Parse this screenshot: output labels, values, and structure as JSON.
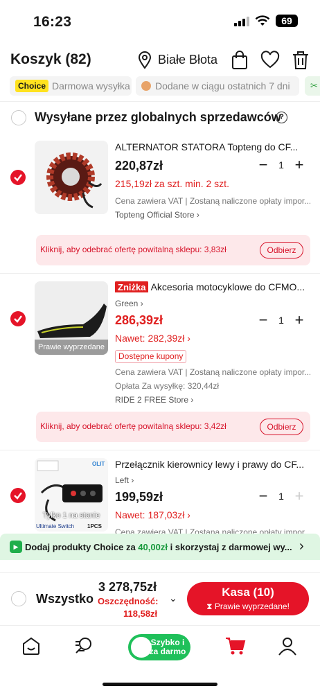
{
  "status": {
    "time": "16:23",
    "battery": "69"
  },
  "header": {
    "title": "Koszyk (82)",
    "location": "Białe Błota"
  },
  "chips": [
    {
      "badge": "Choice",
      "label": "Darmowa wysyłka"
    },
    {
      "label": "Dodane w ciągu ostatnich 7 dni"
    }
  ],
  "section": {
    "title": "Wysyłane przez globalnych sprzedawców",
    "help": "?"
  },
  "items": [
    {
      "title": "ALTERNATOR STATORA Topteng do CF...",
      "price": "220,87zł",
      "sub_price": "215,19zł za szt. min. 2 szt.",
      "vat": "Cena zawiera VAT | Zostaną naliczone opłaty impor...",
      "store": "Topteng Official Store",
      "qty": "1",
      "promo": "Kliknij, aby odebrać ofertę powitalną sklepu: 3,83zł",
      "promo_btn": "Odbierz"
    },
    {
      "tag": "Zniżka",
      "title": "Akcesoria motocyklowe do CFMO...",
      "variant": "Green",
      "price": "286,39zł",
      "sub_price": "Nawet: 282,39zł",
      "coupon": "Dostępne kupony",
      "vat": "Cena zawiera VAT | Zostaną naliczone opłaty impor...",
      "shipping": "Opłata Za wysyłkę: 320,44zł",
      "store": "RIDE 2 FREE Store",
      "qty": "1",
      "stock": "Prawie wyprzedane",
      "promo": "Kliknij, aby odebrać ofertę powitalną sklepu: 3,42zł",
      "promo_btn": "Odbierz"
    },
    {
      "title": "Przełącznik kierownicy lewy i prawy do CF...",
      "variant": "Left",
      "price": "199,59zł",
      "sub_price": "Nawet: 187,03zł",
      "vat": "Cena zawiera VAT | Zostaną naliczone opłaty impor...",
      "qty": "1",
      "stock": "Tylko 1 na stanie",
      "img_brand": "OLIT",
      "img_caption": "Ultimate Switch",
      "img_count": "1PCS"
    }
  ],
  "banner": {
    "prefix": "Dodaj produkty",
    "choice": "Choice",
    "mid": "za",
    "amount": "40,00zł",
    "suffix": "i skorzystaj z darmowej wy..."
  },
  "footer": {
    "select_all": "Wszystko",
    "total": "3 278,75zł",
    "savings_label": "Oszczędność:",
    "savings": "118,58zł",
    "checkout": "Kasa (10)",
    "checkout_sub": "Prawie wyprzedane!"
  },
  "tabs": {
    "promo_line1": "Szybko i",
    "promo_line2": "za darmo"
  },
  "colors": {
    "accent": "#e51428",
    "promo_bg": "#fde8ea",
    "banner_bg": "#dff6e3",
    "tab_promo": "#1fc05a"
  }
}
